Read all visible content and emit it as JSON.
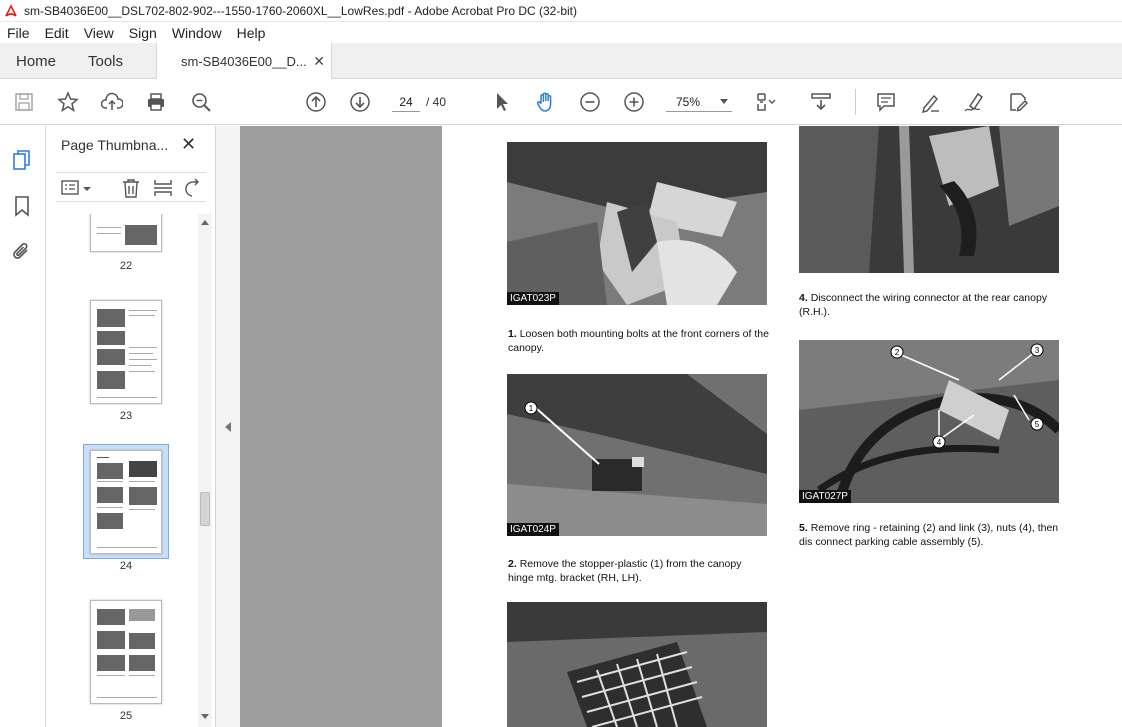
{
  "window": {
    "title": "sm-SB4036E00__DSL702-802-902---1550-1760-2060XL__LowRes.pdf - Adobe Acrobat Pro DC (32-bit)"
  },
  "menu": [
    "File",
    "Edit",
    "View",
    "Sign",
    "Window",
    "Help"
  ],
  "tabs": {
    "home": "Home",
    "tools": "Tools",
    "document": "sm-SB4036E00__D..."
  },
  "toolbar": {
    "current_page": "24",
    "total_pages": "/ 40",
    "zoom": "75%"
  },
  "panel": {
    "title": "Page Thumbna...",
    "thumbnails": [
      {
        "label": "22"
      },
      {
        "label": "23"
      },
      {
        "label": "24",
        "selected": true
      },
      {
        "label": "25"
      }
    ]
  },
  "document": {
    "steps": [
      {
        "num": "1.",
        "text": "Loosen both mounting bolts at the front corners of the canopy."
      },
      {
        "num": "2.",
        "text": "Remove the stopper-plastic (1) from the canopy hinge mtg. bracket (RH, LH)."
      },
      {
        "num": "4.",
        "text": "Disconnect the wiring connector at the rear canopy (R.H.)."
      },
      {
        "num": "5.",
        "text": "Remove ring - retaining (2) and link (3), nuts (4), then dis connect parking cable assembly (5)."
      }
    ],
    "photo_tags": [
      "IGAT023P",
      "IGAT024P",
      "IGAT027P"
    ]
  },
  "colors": {
    "accent": "#3b7dd8",
    "gray_bg": "#9e9e9e"
  }
}
